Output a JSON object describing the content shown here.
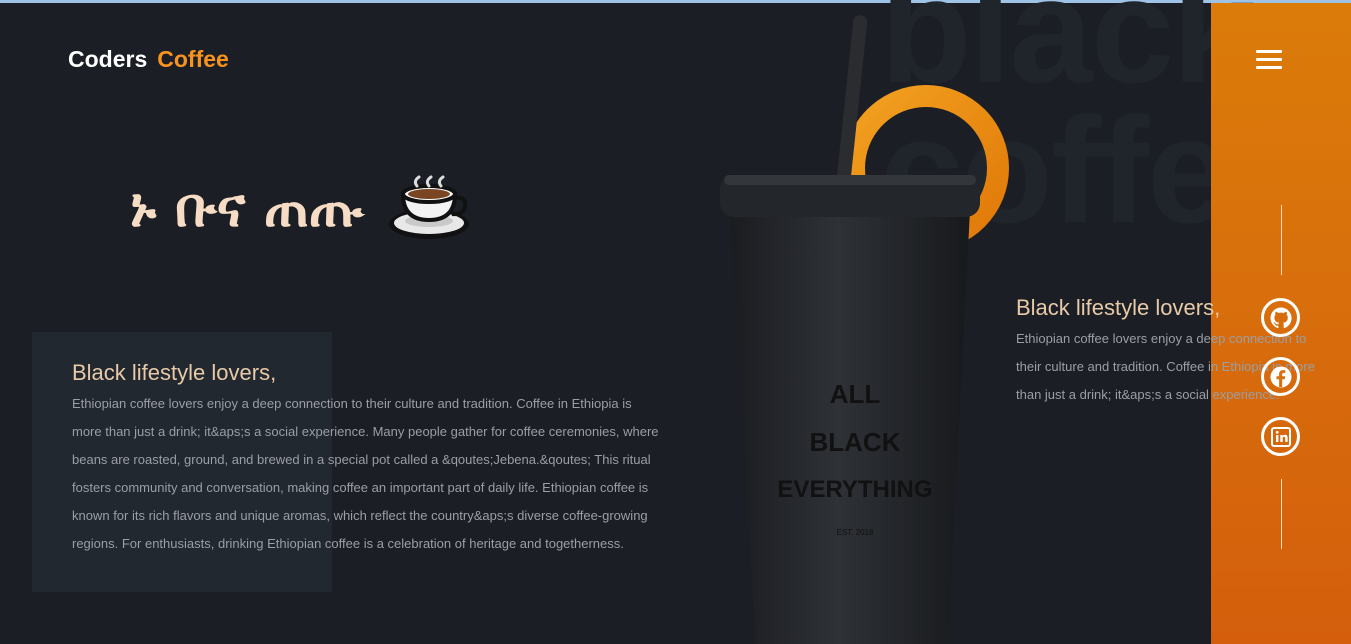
{
  "brand": {
    "part1": "Coders",
    "part2": "Coffee"
  },
  "background_word": "black\ncoffee",
  "headline": {
    "text": "ኑ ቡና ጠጡ",
    "emoji": "☕"
  },
  "cup": {
    "line1": "ALL",
    "line2": "BLACK",
    "line3": "EVERYTHING",
    "est": "EST. 2018"
  },
  "section_left": {
    "title": "Black lifestyle lovers,",
    "body": "Ethiopian coffee lovers enjoy a deep connection to their culture and tradition. Coffee in Ethiopia is more than just a drink; it&aps;s a social experience. Many people gather for coffee ceremonies, where beans are roasted, ground, and brewed in a special pot called a &qoutes;Jebena.&qoutes; This ritual fosters community and conversation, making coffee an important part of daily life. Ethiopian coffee is known for its rich flavors and unique aromas, which reflect the country&aps;s diverse coffee-growing regions. For enthusiasts, drinking Ethiopian coffee is a celebration of heritage and togetherness."
  },
  "section_right": {
    "title": "Black lifestyle lovers,",
    "body": "Ethiopian coffee lovers enjoy a deep connection to their culture and tradition. Coffee in Ethiopia is more than just a drink; it&aps;s a social experience."
  },
  "sidebar": {
    "menu_icon": "hamburger-menu-icon",
    "social": [
      {
        "name": "github-icon"
      },
      {
        "name": "facebook-icon"
      },
      {
        "name": "linkedin-icon"
      }
    ]
  },
  "colors": {
    "accent": "#f7931e",
    "sidebar": "#d76a0c",
    "background": "#1b1f25"
  }
}
